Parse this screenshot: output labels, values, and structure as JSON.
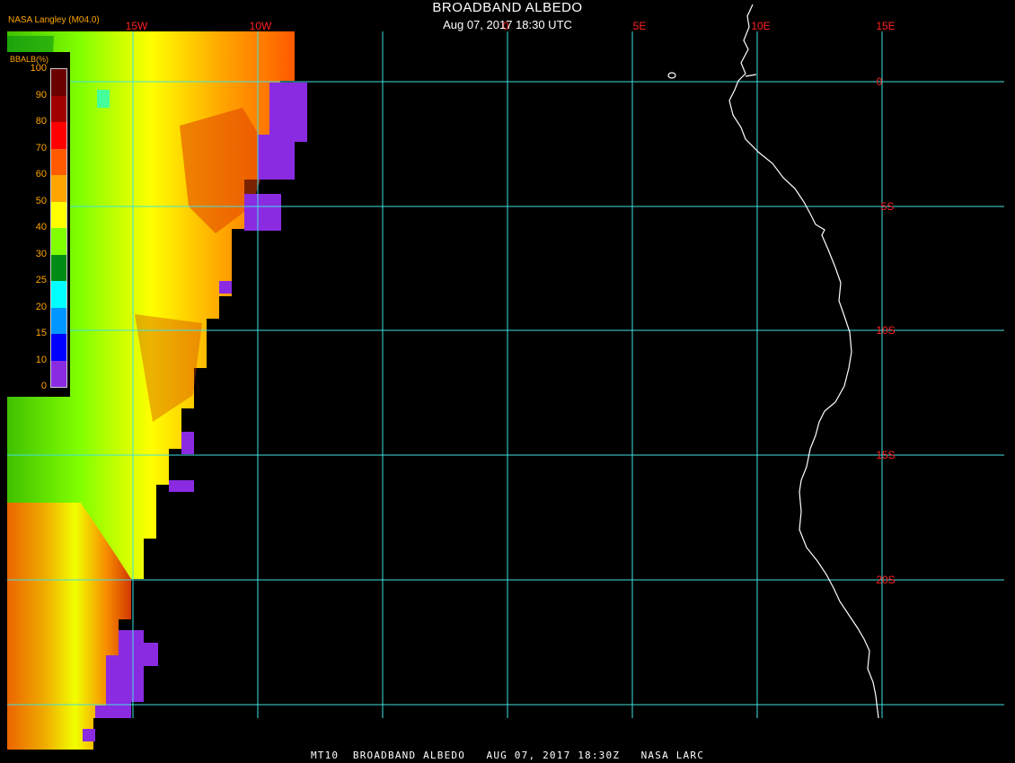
{
  "header": {
    "title": "BROADBAND ALBEDO",
    "subtitle": "Aug 07, 2017 18:30 UTC",
    "agency": "NASA Langley (M04.0)"
  },
  "footer": {
    "text": "MT10  BROADBAND ALBEDO   AUG 07, 2017 18:30Z   NASA LARC"
  },
  "legend": {
    "title": "BBALB(%)",
    "ticks": [
      "100",
      "90",
      "80",
      "70",
      "60",
      "50",
      "40",
      "30",
      "25",
      "20",
      "15",
      "10",
      "0"
    ],
    "colors": [
      "#6b0000",
      "#a00000",
      "#ff0000",
      "#ff5a00",
      "#ffa500",
      "#ffff00",
      "#80ff00",
      "#008c14",
      "#00ffff",
      "#0096ff",
      "#0000ff",
      "#8a2be2"
    ]
  },
  "grid": {
    "color": "#40e0e0",
    "label_color": "#ff2020",
    "lon_labels": [
      "15W",
      "10W",
      "0",
      "5E",
      "10E",
      "15E"
    ],
    "lat_labels": [
      "0",
      "5S",
      "10S",
      "15S",
      "20S"
    ]
  },
  "coastline_color": "#ffffff"
}
